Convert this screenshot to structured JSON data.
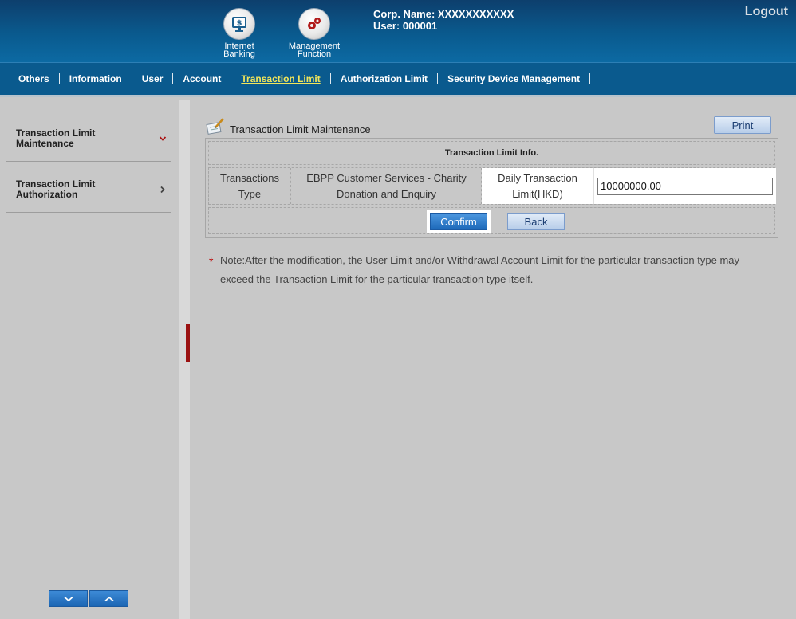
{
  "header": {
    "modules": [
      {
        "label_line1": "Internet",
        "label_line2": "Banking",
        "icon": "internet-banking-icon"
      },
      {
        "label_line1": "Management",
        "label_line2": "Function",
        "icon": "gears-icon"
      }
    ],
    "corp_name": "Corp. Name: XXXXXXXXXXX",
    "user": "User: 000001",
    "logout": "Logout"
  },
  "nav": {
    "items": [
      "Others",
      "Information",
      "User",
      "Account",
      "Transaction Limit",
      "Authorization Limit",
      "Security Device Management"
    ],
    "active": "Transaction Limit"
  },
  "sidebar": {
    "items": [
      {
        "line1": "Transaction Limit",
        "line2": "Maintenance",
        "expanded": true
      },
      {
        "line1": "Transaction Limit",
        "line2": "Authorization",
        "expanded": false
      }
    ]
  },
  "main": {
    "title": "Transaction Limit Maintenance",
    "print_label": "Print",
    "info_header": "Transaction Limit Info.",
    "row": {
      "type_label_line1": "Transactions",
      "type_label_line2": "Type",
      "type_value_line1": "EBPP Customer Services - Charity",
      "type_value_line2": "Donation and Enquiry",
      "limit_label_line1": "Daily Transaction",
      "limit_label_line2": "Limit(HKD)",
      "limit_value": "10000000.00"
    },
    "confirm_label": "Confirm",
    "back_label": "Back",
    "note_marker": "*",
    "note": "Note:After the modification, the User Limit and/or Withdrawal Account Limit for the particular transaction type may exceed the Transaction Limit for the particular transaction type itself."
  },
  "colors": {
    "header_blue": "#0a5a8e",
    "active_nav": "#f2e65a",
    "collapse_tab": "#9b1212",
    "primary_button": "#1d69b9"
  }
}
